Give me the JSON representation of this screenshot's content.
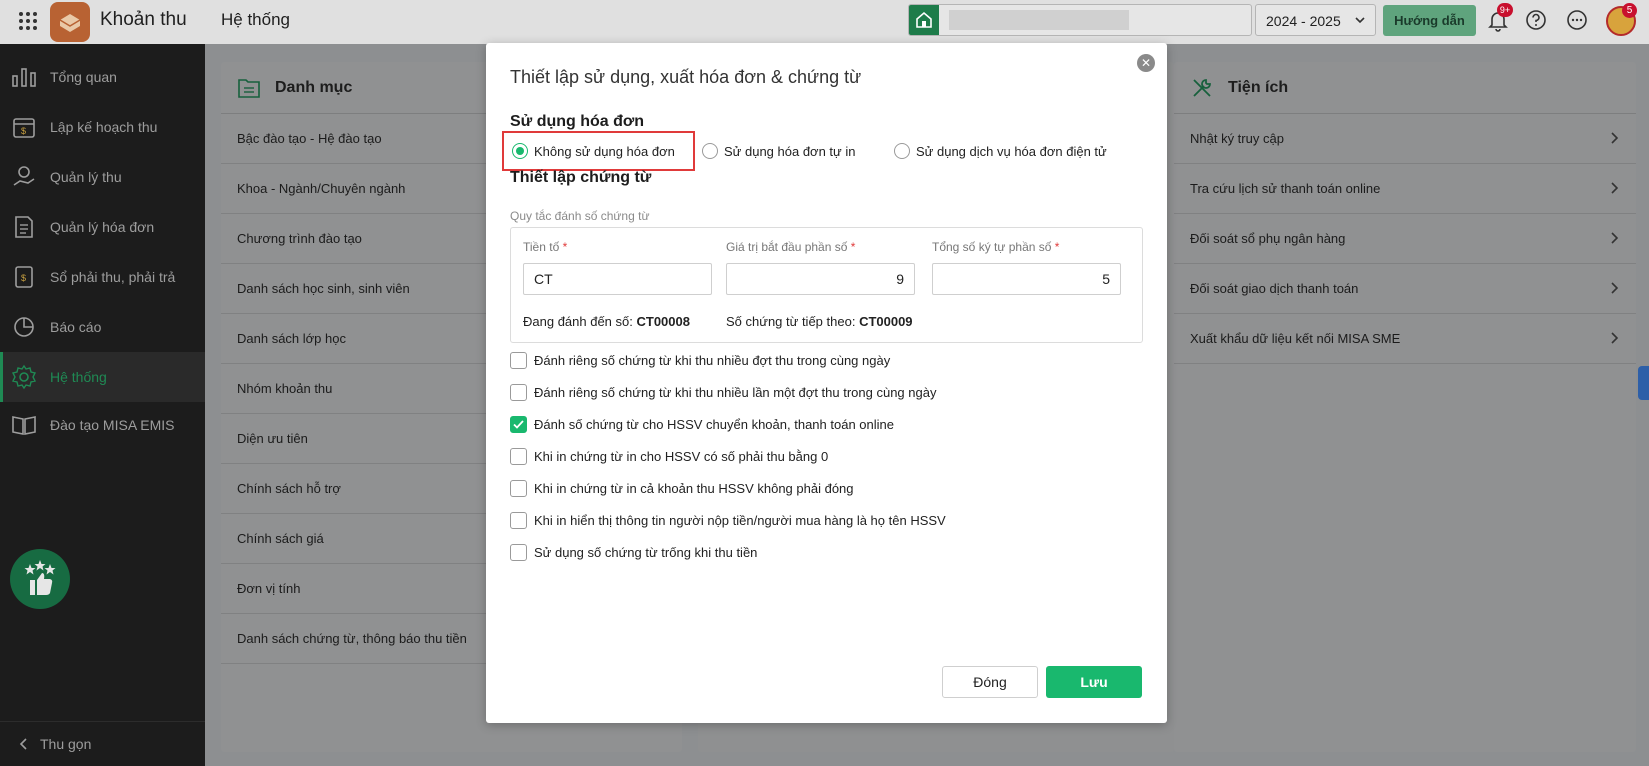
{
  "topbar": {
    "app_title": "Khoản thu",
    "module_title": "Hệ thống",
    "year": "2024 - 2025",
    "guide_label": "Hướng dẫn",
    "notif_badge": "9+",
    "avatar_badge": "5"
  },
  "sidebar": {
    "items": [
      {
        "label": "Tổng quan",
        "icon": "chart-icon"
      },
      {
        "label": "Lập kế hoạch thu",
        "icon": "calendar-money-icon"
      },
      {
        "label": "Quản lý thu",
        "icon": "hand-coin-icon"
      },
      {
        "label": "Quản lý hóa đơn",
        "icon": "invoice-icon"
      },
      {
        "label": "Sổ phải thu, phải trả",
        "icon": "ledger-icon"
      },
      {
        "label": "Báo cáo",
        "icon": "pie-chart-icon"
      },
      {
        "label": "Hệ thống",
        "icon": "gear-icon"
      },
      {
        "label": "Đào tạo MISA EMIS",
        "icon": "book-icon"
      }
    ],
    "collapse_label": "Thu gọn"
  },
  "left_panel": {
    "title": "Danh mục",
    "rows": [
      "Bậc đào tạo - Hệ đào tạo",
      "Khoa - Ngành/Chuyên ngành",
      "Chương trình đào tạo",
      "Danh sách học sinh, sinh viên",
      "Danh sách lớp học",
      "Nhóm khoản thu",
      "Diện ưu tiên",
      "Chính sách hỗ trợ",
      "Chính sách giá",
      "Đơn vị tính",
      "Danh sách chứng từ, thông báo thu tiền"
    ]
  },
  "right_panel": {
    "title": "Tiện ích",
    "rows": [
      "Nhật ký truy cập",
      "Tra cứu lịch sử thanh toán online",
      "Đối soát sổ phụ ngân hàng",
      "Đối soát giao dịch thanh toán",
      "Xuất khẩu dữ liệu kết nối MISA SME"
    ]
  },
  "modal": {
    "title": "Thiết lập sử dụng, xuất hóa đơn & chứng từ",
    "invoice_section": "Sử dụng hóa đơn",
    "radio_options": [
      "Không sử dụng hóa đơn",
      "Sử dụng hóa đơn tự in",
      "Sử dụng dịch vụ hóa đơn điện tử"
    ],
    "selected_radio": 0,
    "voucher_section": "Thiết lập chứng từ",
    "rule_label": "Quy tắc đánh số chứng từ",
    "prefix_label": "Tiền tố",
    "prefix_value": "CT",
    "start_label": "Giá trị bắt đầu phần số",
    "start_value": "9",
    "digits_label": "Tổng số ký tự phần số",
    "digits_value": "5",
    "required_mark": "*",
    "current_label": "Đang đánh đến số:",
    "current_value": "CT00008",
    "next_label": "Số chứng từ tiếp theo:",
    "next_value": "CT00009",
    "options": [
      {
        "label": "Đánh riêng số chứng từ khi thu nhiều đợt thu trong cùng ngày",
        "checked": false
      },
      {
        "label": "Đánh riêng số chứng từ khi thu nhiều lần một đợt thu trong cùng ngày",
        "checked": false
      },
      {
        "label": "Đánh số chứng từ cho HSSV chuyển khoản, thanh toán online",
        "checked": true
      },
      {
        "label": "Khi in chứng từ in cho HSSV có số phải thu bằng 0",
        "checked": false
      },
      {
        "label": "Khi in chứng từ in cả khoản thu HSSV không phải đóng",
        "checked": false
      },
      {
        "label": "Khi in hiển thị thông tin người nộp tiền/người mua hàng là họ tên HSSV",
        "checked": false
      },
      {
        "label": "Sử dụng số chứng từ trống khi thu tiền",
        "checked": false
      }
    ],
    "close_label": "Đóng",
    "save_label": "Lưu"
  },
  "colors": {
    "accent": "#19b86e",
    "highlight": "#e03a3a",
    "sidebar_bg": "#1c1c1c"
  }
}
